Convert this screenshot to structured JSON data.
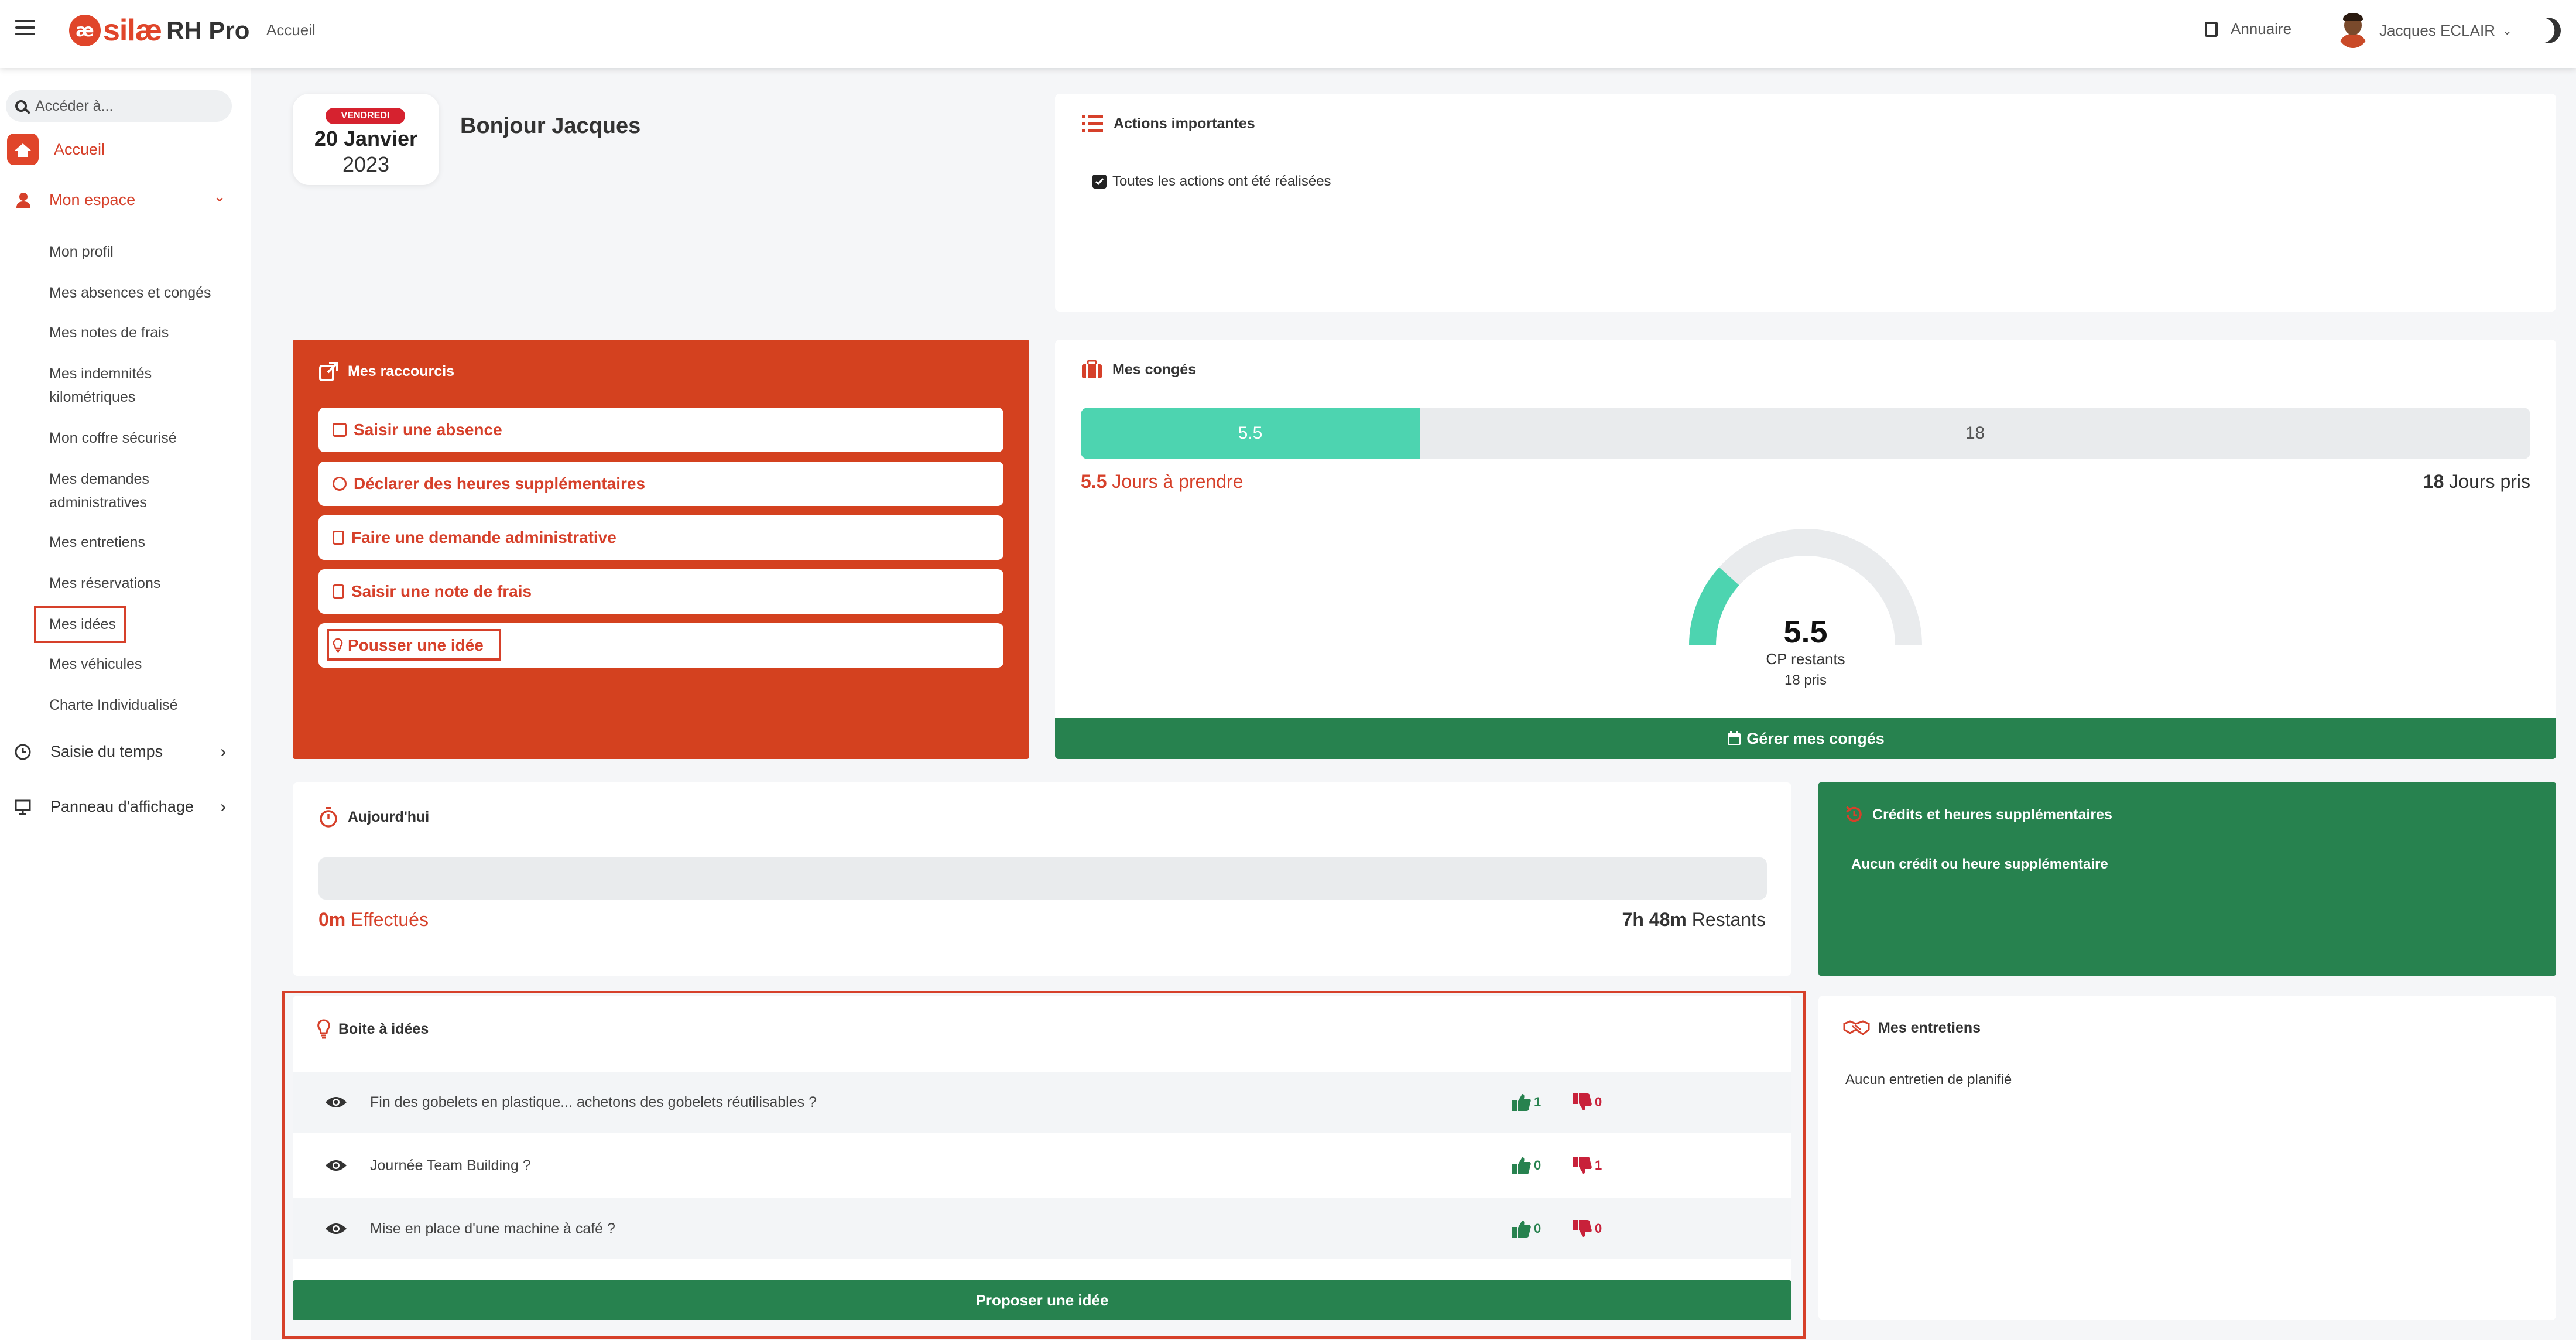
{
  "topbar": {
    "brand_name": "silæ",
    "brand_suffix": "RH Pro",
    "logo_glyph": "æ",
    "breadcrumb": "Accueil",
    "annuaire_label": "Annuaire",
    "user_name": "Jacques ECLAIR",
    "user_chevron": "⌄"
  },
  "sidebar": {
    "search_placeholder": "Accéder à...",
    "home_label": "Accueil",
    "my_space_label": "Mon espace",
    "my_space_items": [
      "Mon profil",
      "Mes absences et congés",
      "Mes notes de frais",
      "Mes indemnités",
      "kilométriques",
      "Mon coffre sécurisé",
      "Mes demandes",
      "administratives",
      "Mes entretiens",
      "Mes réservations",
      "Mes idées",
      "Mes véhicules",
      "Charte Individualisé"
    ],
    "time_label": "Saisie du temps",
    "board_label": "Panneau d'affichage",
    "chev_down": "⌄",
    "chev_right": "›"
  },
  "date": {
    "weekday": "VENDREDI",
    "day": "20 Janvier",
    "year": "2023"
  },
  "greeting": "Bonjour Jacques",
  "actions": {
    "title": "Actions importantes",
    "checkbox_label": "Toutes les actions ont été réalisées",
    "checked": true
  },
  "shortcuts": {
    "title": "Mes raccourcis",
    "items": [
      "Saisir une absence",
      "Déclarer des heures supplémentaires",
      "Faire une demande administrative",
      "Saisir une note de frais",
      "Pousser une idée"
    ]
  },
  "conges": {
    "title": "Mes congés",
    "remaining": "5.5",
    "taken": "18",
    "remaining_suffix": "Jours à prendre",
    "taken_suffix": "Jours pris",
    "gauge_value": "5.5",
    "gauge_label": "CP restants",
    "gauge_sub": "18 pris",
    "remaining_num": 5.5,
    "taken_num": 18,
    "manage_label": "Gérer mes congés",
    "colors": {
      "fill": "#4dd4b0",
      "track": "#e9ebed"
    }
  },
  "today": {
    "title": "Aujourd'hui",
    "done_value": "0m",
    "done_label": "Effectués",
    "remaining_value": "7h 48m",
    "remaining_label": "Restants"
  },
  "credits": {
    "title": "Crédits et heures supplémentaires",
    "message": "Aucun crédit ou heure supplémentaire"
  },
  "ideas": {
    "title": "Boite à idées",
    "rows": [
      {
        "text": "Fin des gobelets en plastique... achetons des gobelets réutilisables ?",
        "up": "1",
        "down": "0"
      },
      {
        "text": "Journée Team Building ?",
        "up": "0",
        "down": "1"
      },
      {
        "text": "Mise en place d'une machine à café ?",
        "up": "0",
        "down": "0"
      }
    ],
    "propose_label": "Proposer une idée"
  },
  "entretiens": {
    "title": "Mes entretiens",
    "message": "Aucun entretien de planifié"
  },
  "colors": {
    "accent": "#d6402a",
    "green": "#27824f",
    "teal": "#4dd4b0",
    "badge_red": "#d6222f"
  }
}
